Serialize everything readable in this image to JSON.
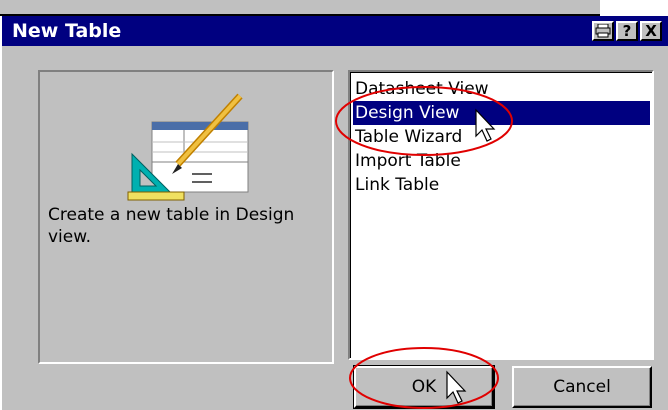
{
  "dialog": {
    "title": "New Table",
    "titlebar_buttons": {
      "print_icon": "printer-icon",
      "help_label": "?",
      "close_label": "X"
    },
    "description": "Create a new table in Design view.",
    "options": [
      "Datasheet View",
      "Design View",
      "Table Wizard",
      "Import Table",
      "Link Table"
    ],
    "selected_option": "Design View",
    "buttons": {
      "ok_label": "OK",
      "cancel_label": "Cancel"
    }
  },
  "colors": {
    "titlebar": "#000080",
    "face": "#c0c0c0",
    "selection": "#000080",
    "annotation": "#e00000"
  }
}
